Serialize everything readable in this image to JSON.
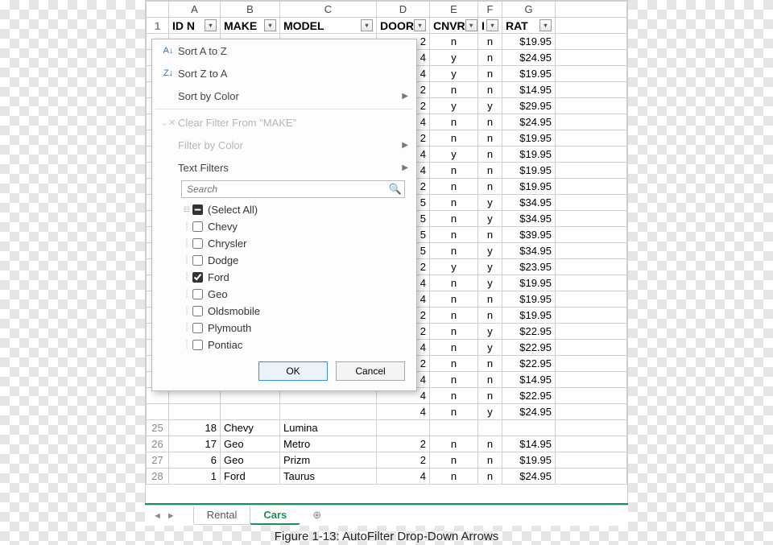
{
  "columns": [
    "A",
    "B",
    "C",
    "D",
    "E",
    "F",
    "G"
  ],
  "header_row_num": "1",
  "headers": {
    "A": "ID N",
    "B": "MAKE",
    "C": "MODEL",
    "D": "DOOR",
    "E": "CNVR",
    "F": "I",
    "G": "RAT"
  },
  "filter_panel": {
    "sort_az": "Sort A to Z",
    "sort_za": "Sort Z to A",
    "sort_color": "Sort by Color",
    "clear": "Clear Filter From \"MAKE\"",
    "filter_color": "Filter by Color",
    "text_filters": "Text Filters",
    "search_placeholder": "Search",
    "select_all": "(Select All)",
    "items": [
      {
        "label": "Chevy",
        "checked": false
      },
      {
        "label": "Chrysler",
        "checked": false
      },
      {
        "label": "Dodge",
        "checked": false
      },
      {
        "label": "Ford",
        "checked": true
      },
      {
        "label": "Geo",
        "checked": false
      },
      {
        "label": "Oldsmobile",
        "checked": false
      },
      {
        "label": "Plymouth",
        "checked": false
      },
      {
        "label": "Pontiac",
        "checked": false
      }
    ],
    "ok": "OK",
    "cancel": "Cancel"
  },
  "rows_top": [
    {
      "D": "2",
      "E": "n",
      "F": "n",
      "G": "$19.95"
    },
    {
      "D": "4",
      "E": "y",
      "F": "n",
      "G": "$24.95"
    },
    {
      "D": "4",
      "E": "y",
      "F": "n",
      "G": "$19.95"
    },
    {
      "D": "2",
      "E": "n",
      "F": "n",
      "G": "$14.95"
    },
    {
      "D": "2",
      "E": "y",
      "F": "y",
      "G": "$29.95"
    },
    {
      "D": "4",
      "E": "n",
      "F": "n",
      "G": "$24.95"
    },
    {
      "D": "2",
      "E": "n",
      "F": "n",
      "G": "$19.95"
    },
    {
      "D": "4",
      "E": "y",
      "F": "n",
      "G": "$19.95"
    },
    {
      "D": "4",
      "E": "n",
      "F": "n",
      "G": "$19.95"
    },
    {
      "D": "2",
      "E": "n",
      "F": "n",
      "G": "$19.95"
    },
    {
      "D": "5",
      "E": "n",
      "F": "y",
      "G": "$34.95"
    },
    {
      "D": "5",
      "E": "n",
      "F": "y",
      "G": "$34.95"
    },
    {
      "D": "5",
      "E": "n",
      "F": "n",
      "G": "$39.95"
    },
    {
      "D": "5",
      "E": "n",
      "F": "y",
      "G": "$34.95"
    },
    {
      "D": "2",
      "E": "y",
      "F": "y",
      "G": "$23.95"
    },
    {
      "D": "4",
      "E": "n",
      "F": "y",
      "G": "$19.95"
    },
    {
      "D": "4",
      "E": "n",
      "F": "n",
      "G": "$19.95"
    },
    {
      "D": "2",
      "E": "n",
      "F": "n",
      "G": "$19.95"
    },
    {
      "D": "2",
      "E": "n",
      "F": "y",
      "G": "$22.95"
    },
    {
      "D": "4",
      "E": "n",
      "F": "y",
      "G": "$22.95"
    },
    {
      "D": "2",
      "E": "n",
      "F": "n",
      "G": "$22.95"
    },
    {
      "D": "4",
      "E": "n",
      "F": "n",
      "G": "$14.95"
    },
    {
      "D": "4",
      "E": "n",
      "F": "n",
      "G": "$22.95"
    }
  ],
  "visible_rows": [
    {
      "n": "",
      "A": "",
      "B": "",
      "C": "",
      "D": "4",
      "E": "n",
      "F": "y",
      "G": "$24.95"
    },
    {
      "n": "25",
      "A": "18",
      "B": "Chevy",
      "C": "Lumina",
      "D": "",
      "E": "",
      "F": "",
      "G": ""
    },
    {
      "n": "26",
      "A": "17",
      "B": "Geo",
      "C": "Metro",
      "D": "2",
      "E": "n",
      "F": "n",
      "G": "$14.95"
    },
    {
      "n": "27",
      "A": "6",
      "B": "Geo",
      "C": "Prizm",
      "D": "2",
      "E": "n",
      "F": "n",
      "G": "$19.95"
    },
    {
      "n": "28",
      "A": "1",
      "B": "Ford",
      "C": "Taurus",
      "D": "4",
      "E": "n",
      "F": "n",
      "G": "$24.95"
    }
  ],
  "tabs": {
    "t1": "Rental",
    "t2": "Cars"
  },
  "caption": "Figure 1-13: AutoFilter Drop-Down Arrows"
}
